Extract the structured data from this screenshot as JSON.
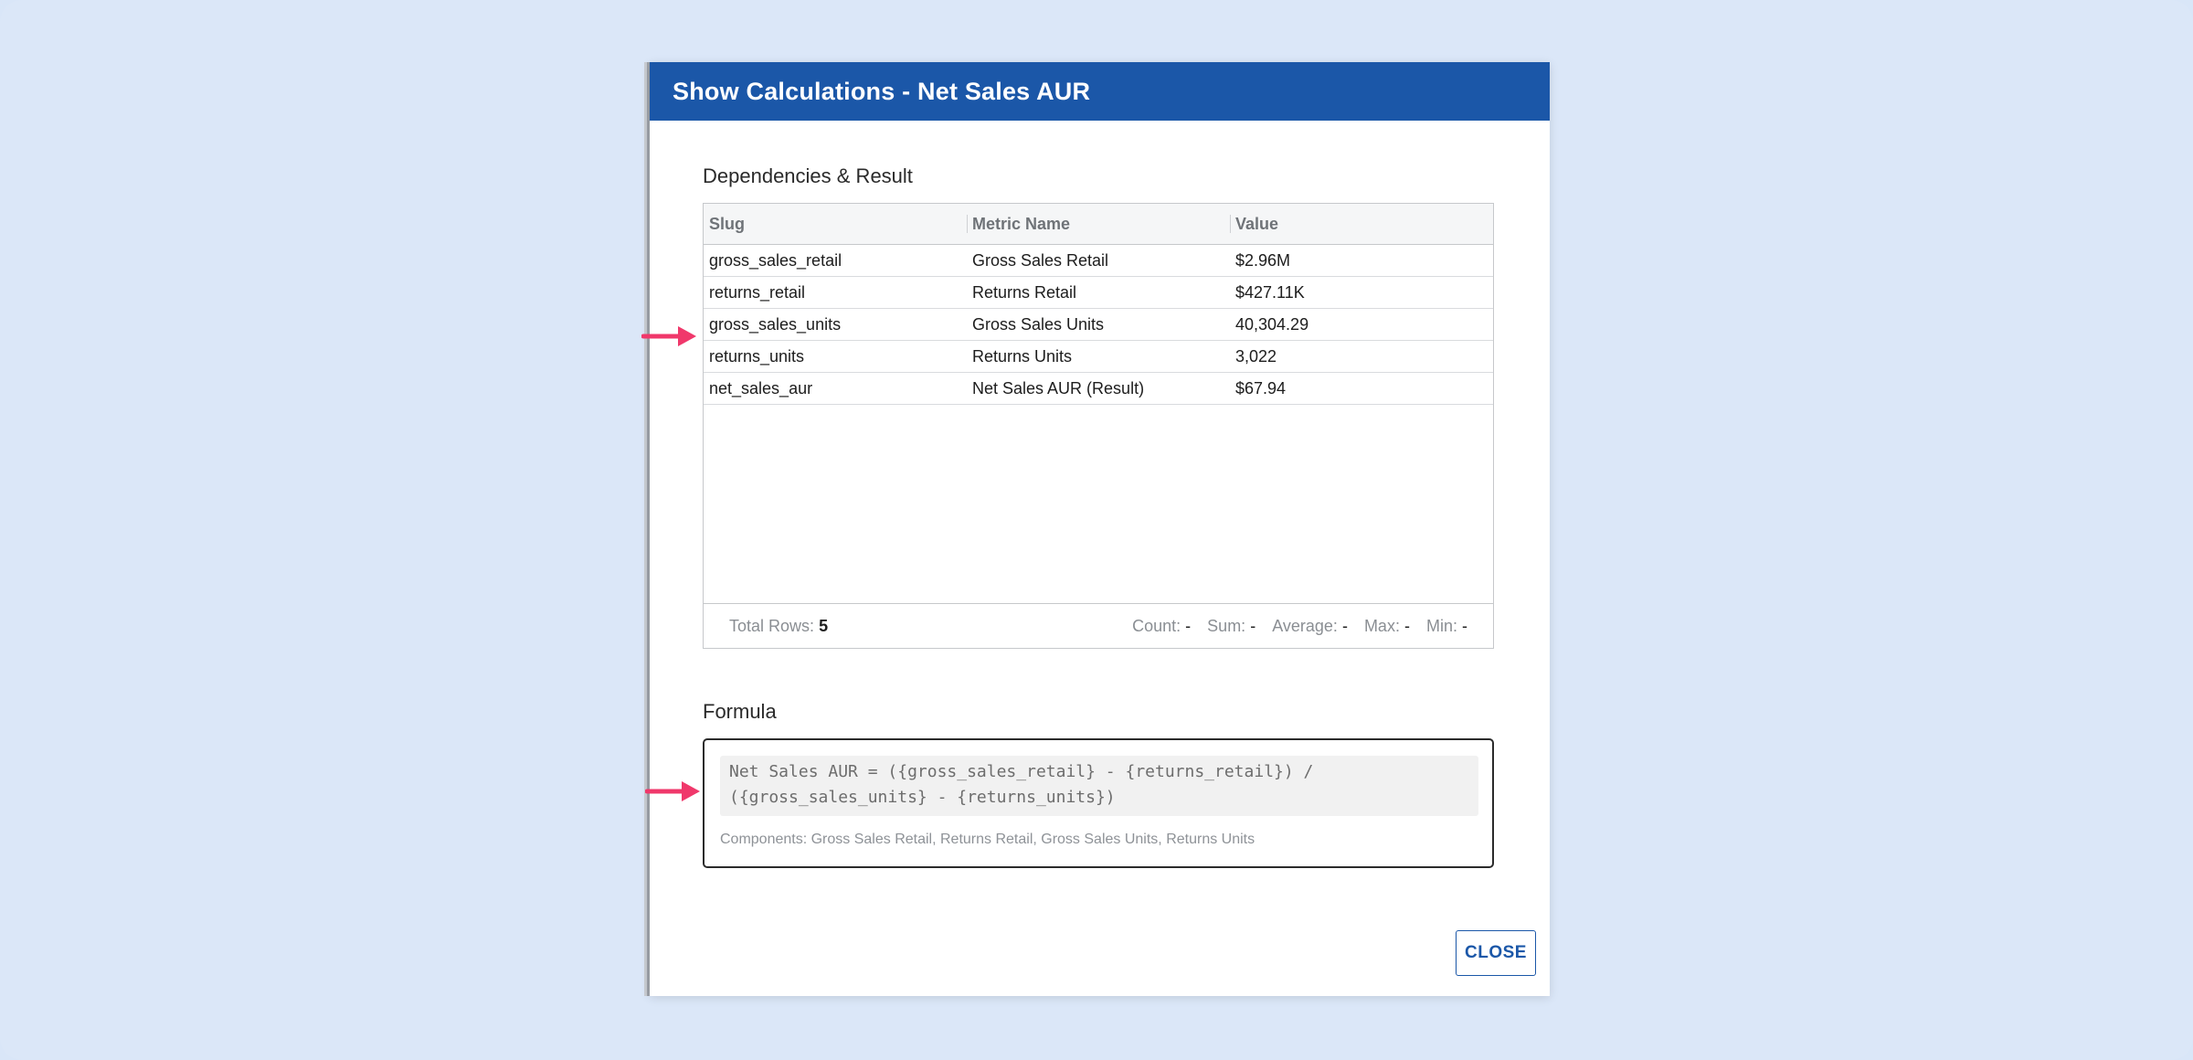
{
  "dialog": {
    "title": "Show Calculations - Net Sales AUR",
    "close_label": "CLOSE"
  },
  "dependencies": {
    "section_title": "Dependencies & Result",
    "columns": [
      "Slug",
      "Metric Name",
      "Value"
    ],
    "rows": [
      {
        "slug": "gross_sales_retail",
        "metric": "Gross Sales Retail",
        "value": "$2.96M"
      },
      {
        "slug": "returns_retail",
        "metric": "Returns Retail",
        "value": "$427.11K"
      },
      {
        "slug": "gross_sales_units",
        "metric": "Gross Sales Units",
        "value": "40,304.29"
      },
      {
        "slug": "returns_units",
        "metric": "Returns Units",
        "value": "3,022"
      },
      {
        "slug": "net_sales_aur",
        "metric": "Net Sales AUR (Result)",
        "value": "$67.94"
      }
    ],
    "footer": {
      "total_rows_label": "Total Rows:",
      "total_rows_value": "5",
      "stats": [
        {
          "label": "Count:",
          "value": "-"
        },
        {
          "label": "Sum:",
          "value": "-"
        },
        {
          "label": "Average:",
          "value": "-"
        },
        {
          "label": "Max:",
          "value": "-"
        },
        {
          "label": "Min:",
          "value": "-"
        }
      ]
    }
  },
  "formula": {
    "section_title": "Formula",
    "line1": "Net Sales AUR = ({gross_sales_retail} - {returns_retail}) /",
    "line2": "({gross_sales_units} - {returns_units})",
    "components": "Components: Gross Sales Retail, Returns Retail, Gross Sales Units, Returns Units"
  },
  "colors": {
    "title_bar": "#1b57a8",
    "arrow": "#f0386b",
    "background": "#d9e6f8"
  }
}
